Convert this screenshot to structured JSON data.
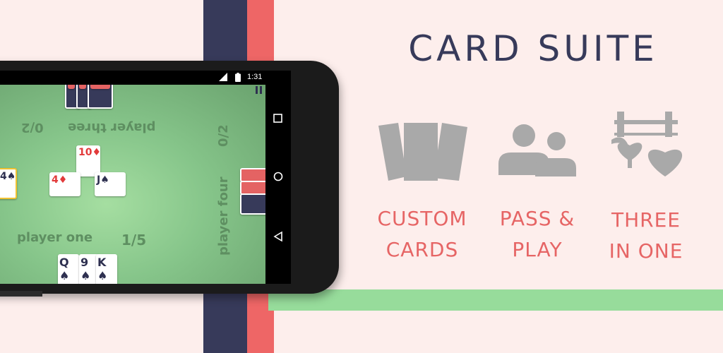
{
  "colors": {
    "background": "#fdeeec",
    "navy": "#373a5a",
    "coral": "#ee6666",
    "green_band": "#97dc9b",
    "felt": "#86c58a",
    "icon_gray": "#a9a9a9"
  },
  "title": "CARD SUITE",
  "features": [
    {
      "icon": "cards-icon",
      "line1": "CUSTOM",
      "line2": "CARDS"
    },
    {
      "icon": "people-icon",
      "line1": "PASS &",
      "line2": "PLAY"
    },
    {
      "icon": "bridge-suits-icon",
      "line1": "THREE",
      "line2": "IN ONE"
    }
  ],
  "phone": {
    "status_time": "1:31",
    "signal_label": "3G",
    "players": {
      "one": {
        "name": "player one",
        "score": "1/5"
      },
      "three": {
        "name": "player three",
        "score": "0/2"
      },
      "four": {
        "name": "player four",
        "score": "0/2"
      }
    },
    "center_cards": {
      "top": {
        "rank": "10",
        "suit": "♦"
      },
      "left": {
        "rank": "4",
        "suit": "♦"
      },
      "right": {
        "rank": "J",
        "suit": "♠"
      }
    },
    "left_card": {
      "rank": "4",
      "suit": "♠"
    },
    "hand_cards": [
      {
        "rank": "Q",
        "suit": "♠"
      },
      {
        "rank": "9",
        "suit": "♠"
      },
      {
        "rank": "K",
        "suit": "♠"
      }
    ]
  }
}
